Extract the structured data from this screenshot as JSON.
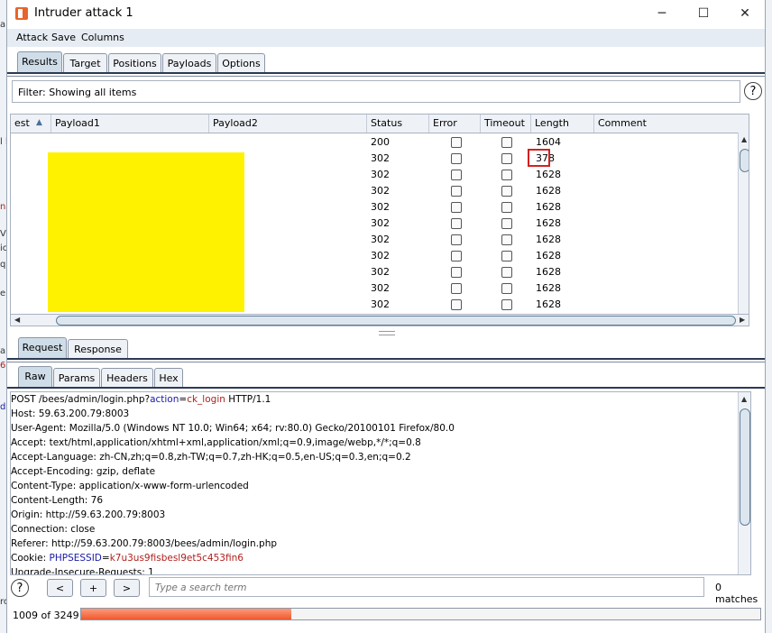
{
  "window": {
    "title": "Intruder attack 1",
    "minimize": "─",
    "maximize": "☐",
    "close": "✕"
  },
  "menu": [
    "Attack",
    "Save",
    "Columns"
  ],
  "tabs": [
    "Results",
    "Target",
    "Positions",
    "Payloads",
    "Options"
  ],
  "filter": {
    "text": "Filter:  Showing all items"
  },
  "help_glyph": "?",
  "table": {
    "columns": [
      "est",
      "Payload1",
      "Payload2",
      "Status",
      "Error",
      "Timeout",
      "Length",
      "Comment"
    ],
    "sort_glyph": "▲",
    "rows": [
      {
        "status": "200",
        "length": "1604"
      },
      {
        "status": "302",
        "length": "378"
      },
      {
        "status": "302",
        "length": "1628"
      },
      {
        "status": "302",
        "length": "1628"
      },
      {
        "status": "302",
        "length": "1628"
      },
      {
        "status": "302",
        "length": "1628"
      },
      {
        "status": "302",
        "length": "1628"
      },
      {
        "status": "302",
        "length": "1628"
      },
      {
        "status": "302",
        "length": "1628"
      },
      {
        "status": "302",
        "length": "1628"
      },
      {
        "status": "302",
        "length": "1628"
      }
    ]
  },
  "bottom_tabs": [
    "Request",
    "Response"
  ],
  "sub_tabs": [
    "Raw",
    "Params",
    "Headers",
    "Hex"
  ],
  "request": {
    "line1": {
      "pre": "POST /bees/admin/login.php?",
      "param": "action",
      "eq": "=",
      "value": "ck_login",
      "post": " HTTP/1.1"
    },
    "lines": [
      "Host: 59.63.200.79:8003",
      "User-Agent: Mozilla/5.0 (Windows NT 10.0; Win64; x64; rv:80.0) Gecko/20100101 Firefox/80.0",
      "Accept: text/html,application/xhtml+xml,application/xml;q=0.9,image/webp,*/*;q=0.8",
      "Accept-Language: zh-CN,zh;q=0.8,zh-TW;q=0.7,zh-HK;q=0.5,en-US;q=0.3,en;q=0.2",
      "Accept-Encoding: gzip, deflate",
      "Content-Type: application/x-www-form-urlencoded",
      "Content-Length: 76",
      "Origin: http://59.63.200.79:8003",
      "Connection: close",
      "Referer: http://59.63.200.79:8003/bees/admin/login.php"
    ],
    "cookie": {
      "pre": "Cookie: ",
      "name": "PHPSESSID",
      "eq": "=",
      "value": "k7u3us9fisbesl9et5c453fin6"
    },
    "last_line": "Upgrade-Insecure-Requests: 1"
  },
  "search": {
    "prev": "<",
    "add": "+",
    "next": ">",
    "placeholder": "Type a search term",
    "matches": "0 matches"
  },
  "status": {
    "count": "1009 of 3249",
    "progress": 0.31
  },
  "background_fragments": [
    "a",
    "l b",
    "n",
    "V",
    "ic",
    "q=",
    "er",
    "ai",
    "63",
    "de",
    "ro"
  ]
}
